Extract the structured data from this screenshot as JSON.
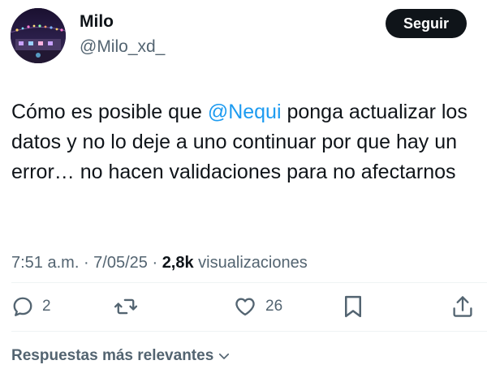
{
  "author": {
    "display_name": "Milo",
    "handle": "@Milo_xd_"
  },
  "follow_label": "Seguir",
  "tweet": {
    "text_before": "Cómo es posible que ",
    "mention": "@Nequi",
    "text_after": " ponga actualizar los datos y no lo deje a uno continuar por que hay un error… no hacen validaciones para no afectarnos"
  },
  "meta": {
    "time": "7:51 a.m.",
    "separator_1": " · ",
    "date": "7/05/25",
    "separator_2": " · ",
    "views_count": "2,8k",
    "views_label": " visualizaciones"
  },
  "actions": {
    "reply_count": "2",
    "like_count": "26",
    "icons": [
      "reply-icon",
      "retweet-icon",
      "like-icon",
      "bookmark-icon",
      "share-icon"
    ]
  },
  "replies_sort_label": "Respuestas más relevantes",
  "colors": {
    "text_primary": "#0f1419",
    "text_secondary": "#536471",
    "mention": "#1d9bf0",
    "button_bg": "#0f1419"
  }
}
